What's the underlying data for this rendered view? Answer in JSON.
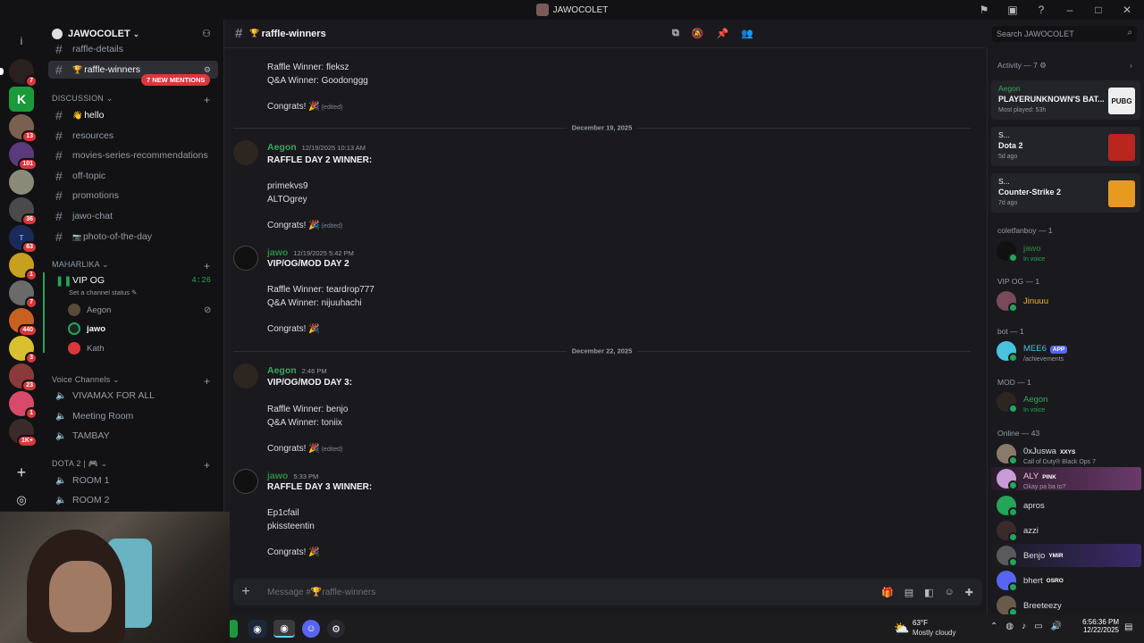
{
  "window": {
    "title": "JAWOCOLET"
  },
  "server": {
    "name": "JAWOCOLET",
    "new_mentions": "7 NEW MENTIONS"
  },
  "rail_badges": [
    "7",
    "13",
    "101",
    "36",
    "63",
    "1",
    "7",
    "440",
    "3",
    "23",
    "1",
    "1K+"
  ],
  "channels": {
    "partial_top": "raffle-details",
    "active": "raffle-winners",
    "discussion_cat": "DISCUSSION",
    "discussion": [
      "hello",
      "resources",
      "movies-series-recommendations",
      "off-topic",
      "promotions",
      "jawo-chat",
      "photo-of-the-day"
    ],
    "maharlika_cat": "MAHARLIKA",
    "vip_og": "VIP OG",
    "vip_og_time": "4:26",
    "set_status": "Set a channel status",
    "voice_users": [
      "Aegon",
      "jawo",
      "Kath"
    ],
    "voice_cat": "Voice Channels",
    "voice": [
      "VIVAMAX FOR ALL",
      "Meeting Room",
      "TAMBAY"
    ],
    "dota_cat": "DOTA 2 |",
    "dota": [
      "ROOM 1",
      "ROOM 2"
    ]
  },
  "chat": {
    "channel_title": "raffle-winners",
    "search_placeholder": "Search JAWOCOLET",
    "composer_placeholder": "Message #🏆raffle-winners",
    "top_lines": [
      "Raffle Winner: fleksz",
      "Q&A Winner: Goodonggg"
    ],
    "congrats": "Congrats! 🎉",
    "edited": "(edited)",
    "date1": "December 19, 2025",
    "date2": "December 22, 2025",
    "m1": {
      "author": "Aegon",
      "ts": "12/19/2025 10:13 AM",
      "title": "RAFFLE DAY 2 WINNER:",
      "lines": [
        "primekvs9",
        "ALTOgrey"
      ]
    },
    "m2": {
      "author": "jawo",
      "ts": "12/19/2025 5:42 PM",
      "title": "VIP/OG/MOD DAY 2",
      "lines": [
        "Raffle Winner: teardrop777",
        "Q&A Winner: nijuuhachi"
      ]
    },
    "m3": {
      "author": "Aegon",
      "ts": "2:46 PM",
      "title": "VIP/OG/MOD DAY 3:",
      "lines": [
        "Raffle Winner: benjo",
        "Q&A Winner: toniix"
      ]
    },
    "m4": {
      "author": "jawo",
      "ts": "5:33 PM",
      "title": "RAFFLE DAY 3 WINNER:",
      "lines": [
        "Ep1cfail",
        "pkissteentin"
      ]
    }
  },
  "members": {
    "activity": "Activity — 7",
    "cards": [
      {
        "who": "Aegon",
        "game": "PLAYERUNKNOWN'S BAT...",
        "sub": "Most played: 53h"
      },
      {
        "who": "S...",
        "game": "Dota 2",
        "sub": "5d ago"
      },
      {
        "who": "S...",
        "game": "Counter-Strike 2",
        "sub": "7d ago"
      }
    ],
    "sections": {
      "colet": "coletfanboy — 1",
      "vip": "VIP OG — 1",
      "bot": "bot — 1",
      "mod": "MOD — 1",
      "online": "Online — 43"
    },
    "colet_member": {
      "name": "jawo",
      "status": "In voice"
    },
    "vip_member": {
      "name": "Jinuuu"
    },
    "bot_member": {
      "name": "MEE6",
      "tag": "APP",
      "status": "/achievements"
    },
    "mod_member": {
      "name": "Aegon",
      "status": "In voice"
    },
    "online": [
      {
        "name": "0xJuswa",
        "tag": "XXYS",
        "status": "Call of Duty® Black Ops 7"
      },
      {
        "name": "ALY",
        "tag": "PINK",
        "status": "Okay pa ba to?"
      },
      {
        "name": "apros",
        "tag": "",
        "status": ""
      },
      {
        "name": "azzi",
        "tag": "",
        "status": ""
      },
      {
        "name": "Benjo",
        "tag": "YMIR",
        "status": ""
      },
      {
        "name": "bhert",
        "tag": "OSRO",
        "status": ""
      },
      {
        "name": "Breeteezy",
        "tag": "",
        "status": ""
      }
    ]
  },
  "taskbar": {
    "temp": "63°F",
    "weather": "Mostly cloudy",
    "time": "6:56:36 PM",
    "date": "12/22/2025"
  },
  "colors": {
    "accent": "#5865f2",
    "green": "#23a55a",
    "red": "#da373c",
    "aegon": "#3ba55d",
    "jawo": "#2b8a3e"
  }
}
